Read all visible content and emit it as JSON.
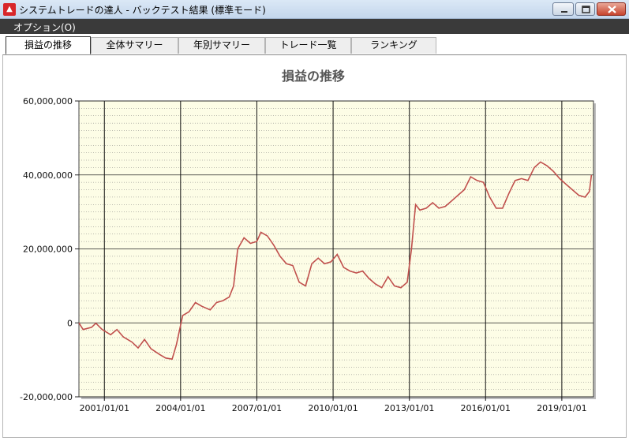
{
  "window": {
    "title": "システムトレードの達人 - バックテスト結果 (標準モード)",
    "app_icon": "app-logo-icon",
    "controls": [
      "minimize-icon",
      "maximize-icon",
      "close-icon"
    ]
  },
  "menu": {
    "items": [
      {
        "label": "オプション(O)"
      }
    ]
  },
  "tabs": [
    {
      "label": "損益の推移",
      "active": true
    },
    {
      "label": "全体サマリー",
      "active": false
    },
    {
      "label": "年別サマリー",
      "active": false
    },
    {
      "label": "トレード一覧",
      "active": false
    },
    {
      "label": "ランキング",
      "active": false
    }
  ],
  "colors": {
    "plot_background": "#fdfde6",
    "line": "#c0504d",
    "menubar": "#3a3a3a"
  },
  "chart_data": {
    "type": "line",
    "title": "損益の推移",
    "xlabel": "",
    "ylabel": "",
    "xlim": [
      "2000-01-01",
      "2020-03-31"
    ],
    "ylim": [
      -20000000,
      60000000
    ],
    "y_ticks": [
      {
        "value": -20000000,
        "label": "-20,000,000"
      },
      {
        "value": 0,
        "label": "0"
      },
      {
        "value": 20000000,
        "label": "20,000,000"
      },
      {
        "value": 40000000,
        "label": "40,000,000"
      },
      {
        "value": 60000000,
        "label": "60,000,000"
      }
    ],
    "x_ticks": [
      {
        "value": "2001-01-01",
        "label": "2001/01/01"
      },
      {
        "value": "2004-01-01",
        "label": "2004/01/01"
      },
      {
        "value": "2007-01-01",
        "label": "2007/01/01"
      },
      {
        "value": "2010-01-01",
        "label": "2010/01/01"
      },
      {
        "value": "2013-01-01",
        "label": "2013/01/01"
      },
      {
        "value": "2016-01-01",
        "label": "2016/01/01"
      },
      {
        "value": "2019-01-01",
        "label": "2019/01/01"
      }
    ],
    "grid": true,
    "legend": "none",
    "series": [
      {
        "x": [
          "2000-01-01",
          "2000-03-01",
          "2000-07-01",
          "2000-09-01",
          "2000-12-01",
          "2001-04-01",
          "2001-07-01",
          "2001-10-01",
          "2002-02-01",
          "2002-05-01",
          "2002-08-01",
          "2002-11-01",
          "2003-03-01",
          "2003-06-01",
          "2003-09-01",
          "2003-11-01",
          "2004-02-01",
          "2004-05-01",
          "2004-08-01",
          "2004-11-01",
          "2005-03-01",
          "2005-06-01",
          "2005-09-01",
          "2005-12-01",
          "2006-02-01",
          "2006-04-01",
          "2006-07-01",
          "2006-10-01",
          "2007-01-01",
          "2007-03-01",
          "2007-06-01",
          "2007-09-01",
          "2007-12-01",
          "2008-03-01",
          "2008-06-01",
          "2008-09-01",
          "2008-12-01",
          "2009-03-01",
          "2009-06-01",
          "2009-09-01",
          "2009-12-01",
          "2010-03-01",
          "2010-06-01",
          "2010-09-01",
          "2010-12-01",
          "2011-03-01",
          "2011-06-01",
          "2011-09-01",
          "2011-12-01",
          "2012-03-01",
          "2012-06-01",
          "2012-09-01",
          "2012-12-01",
          "2013-02-01",
          "2013-04-01",
          "2013-06-01",
          "2013-09-01",
          "2013-12-01",
          "2014-03-01",
          "2014-06-01",
          "2014-09-01",
          "2014-12-01",
          "2015-03-01",
          "2015-06-01",
          "2015-09-01",
          "2015-12-01",
          "2016-03-01",
          "2016-06-01",
          "2016-09-01",
          "2016-12-01",
          "2017-03-01",
          "2017-06-01",
          "2017-09-01",
          "2017-12-01",
          "2018-03-01",
          "2018-06-01",
          "2018-09-01",
          "2018-12-01",
          "2019-03-01",
          "2019-06-01",
          "2019-09-01",
          "2019-12-01",
          "2020-02-01",
          "2020-03-01"
        ],
        "y": [
          0,
          -1800000,
          -1200000,
          -100000,
          -1800000,
          -3200000,
          -1800000,
          -3800000,
          -5200000,
          -6800000,
          -4500000,
          -7000000,
          -8500000,
          -9500000,
          -9800000,
          -6000000,
          2000000,
          3000000,
          5500000,
          4500000,
          3500000,
          5500000,
          6000000,
          7000000,
          10000000,
          20000000,
          23000000,
          21500000,
          22000000,
          24500000,
          23500000,
          21000000,
          18000000,
          16000000,
          15500000,
          11000000,
          10000000,
          16000000,
          17500000,
          16000000,
          16500000,
          18500000,
          15000000,
          14000000,
          13500000,
          14000000,
          12000000,
          10500000,
          9500000,
          12500000,
          10000000,
          9500000,
          11000000,
          20000000,
          32000000,
          30500000,
          31000000,
          32500000,
          31000000,
          31500000,
          33000000,
          34500000,
          36000000,
          39500000,
          38500000,
          38000000,
          34000000,
          31000000,
          31000000,
          35000000,
          38500000,
          39000000,
          38500000,
          42000000,
          43500000,
          42500000,
          41000000,
          39000000,
          37500000,
          36000000,
          34500000,
          34000000,
          35500000,
          40000000
        ]
      }
    ]
  }
}
